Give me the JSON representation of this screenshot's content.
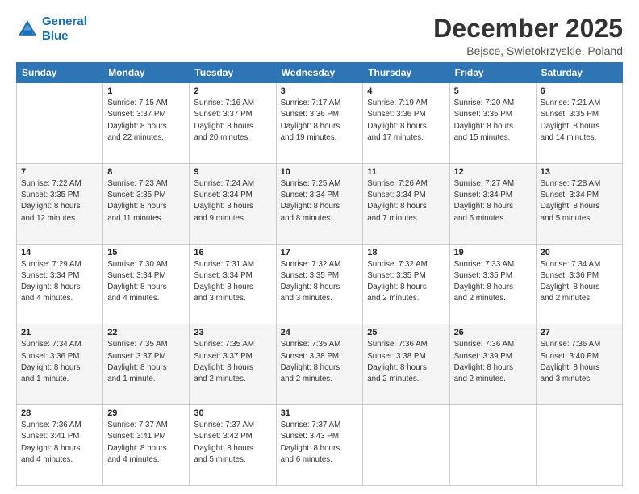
{
  "logo": {
    "line1": "General",
    "line2": "Blue"
  },
  "header": {
    "title": "December 2025",
    "subtitle": "Bejsce, Swietokrzyskie, Poland"
  },
  "weekdays": [
    "Sunday",
    "Monday",
    "Tuesday",
    "Wednesday",
    "Thursday",
    "Friday",
    "Saturday"
  ],
  "weeks": [
    [
      {
        "day": "",
        "info": ""
      },
      {
        "day": "1",
        "info": "Sunrise: 7:15 AM\nSunset: 3:37 PM\nDaylight: 8 hours\nand 22 minutes."
      },
      {
        "day": "2",
        "info": "Sunrise: 7:16 AM\nSunset: 3:37 PM\nDaylight: 8 hours\nand 20 minutes."
      },
      {
        "day": "3",
        "info": "Sunrise: 7:17 AM\nSunset: 3:36 PM\nDaylight: 8 hours\nand 19 minutes."
      },
      {
        "day": "4",
        "info": "Sunrise: 7:19 AM\nSunset: 3:36 PM\nDaylight: 8 hours\nand 17 minutes."
      },
      {
        "day": "5",
        "info": "Sunrise: 7:20 AM\nSunset: 3:35 PM\nDaylight: 8 hours\nand 15 minutes."
      },
      {
        "day": "6",
        "info": "Sunrise: 7:21 AM\nSunset: 3:35 PM\nDaylight: 8 hours\nand 14 minutes."
      }
    ],
    [
      {
        "day": "7",
        "info": "Sunrise: 7:22 AM\nSunset: 3:35 PM\nDaylight: 8 hours\nand 12 minutes."
      },
      {
        "day": "8",
        "info": "Sunrise: 7:23 AM\nSunset: 3:35 PM\nDaylight: 8 hours\nand 11 minutes."
      },
      {
        "day": "9",
        "info": "Sunrise: 7:24 AM\nSunset: 3:34 PM\nDaylight: 8 hours\nand 9 minutes."
      },
      {
        "day": "10",
        "info": "Sunrise: 7:25 AM\nSunset: 3:34 PM\nDaylight: 8 hours\nand 8 minutes."
      },
      {
        "day": "11",
        "info": "Sunrise: 7:26 AM\nSunset: 3:34 PM\nDaylight: 8 hours\nand 7 minutes."
      },
      {
        "day": "12",
        "info": "Sunrise: 7:27 AM\nSunset: 3:34 PM\nDaylight: 8 hours\nand 6 minutes."
      },
      {
        "day": "13",
        "info": "Sunrise: 7:28 AM\nSunset: 3:34 PM\nDaylight: 8 hours\nand 5 minutes."
      }
    ],
    [
      {
        "day": "14",
        "info": "Sunrise: 7:29 AM\nSunset: 3:34 PM\nDaylight: 8 hours\nand 4 minutes."
      },
      {
        "day": "15",
        "info": "Sunrise: 7:30 AM\nSunset: 3:34 PM\nDaylight: 8 hours\nand 4 minutes."
      },
      {
        "day": "16",
        "info": "Sunrise: 7:31 AM\nSunset: 3:34 PM\nDaylight: 8 hours\nand 3 minutes."
      },
      {
        "day": "17",
        "info": "Sunrise: 7:32 AM\nSunset: 3:35 PM\nDaylight: 8 hours\nand 3 minutes."
      },
      {
        "day": "18",
        "info": "Sunrise: 7:32 AM\nSunset: 3:35 PM\nDaylight: 8 hours\nand 2 minutes."
      },
      {
        "day": "19",
        "info": "Sunrise: 7:33 AM\nSunset: 3:35 PM\nDaylight: 8 hours\nand 2 minutes."
      },
      {
        "day": "20",
        "info": "Sunrise: 7:34 AM\nSunset: 3:36 PM\nDaylight: 8 hours\nand 2 minutes."
      }
    ],
    [
      {
        "day": "21",
        "info": "Sunrise: 7:34 AM\nSunset: 3:36 PM\nDaylight: 8 hours\nand 1 minute."
      },
      {
        "day": "22",
        "info": "Sunrise: 7:35 AM\nSunset: 3:37 PM\nDaylight: 8 hours\nand 1 minute."
      },
      {
        "day": "23",
        "info": "Sunrise: 7:35 AM\nSunset: 3:37 PM\nDaylight: 8 hours\nand 2 minutes."
      },
      {
        "day": "24",
        "info": "Sunrise: 7:35 AM\nSunset: 3:38 PM\nDaylight: 8 hours\nand 2 minutes."
      },
      {
        "day": "25",
        "info": "Sunrise: 7:36 AM\nSunset: 3:38 PM\nDaylight: 8 hours\nand 2 minutes."
      },
      {
        "day": "26",
        "info": "Sunrise: 7:36 AM\nSunset: 3:39 PM\nDaylight: 8 hours\nand 2 minutes."
      },
      {
        "day": "27",
        "info": "Sunrise: 7:36 AM\nSunset: 3:40 PM\nDaylight: 8 hours\nand 3 minutes."
      }
    ],
    [
      {
        "day": "28",
        "info": "Sunrise: 7:36 AM\nSunset: 3:41 PM\nDaylight: 8 hours\nand 4 minutes."
      },
      {
        "day": "29",
        "info": "Sunrise: 7:37 AM\nSunset: 3:41 PM\nDaylight: 8 hours\nand 4 minutes."
      },
      {
        "day": "30",
        "info": "Sunrise: 7:37 AM\nSunset: 3:42 PM\nDaylight: 8 hours\nand 5 minutes."
      },
      {
        "day": "31",
        "info": "Sunrise: 7:37 AM\nSunset: 3:43 PM\nDaylight: 8 hours\nand 6 minutes."
      },
      {
        "day": "",
        "info": ""
      },
      {
        "day": "",
        "info": ""
      },
      {
        "day": "",
        "info": ""
      }
    ]
  ]
}
